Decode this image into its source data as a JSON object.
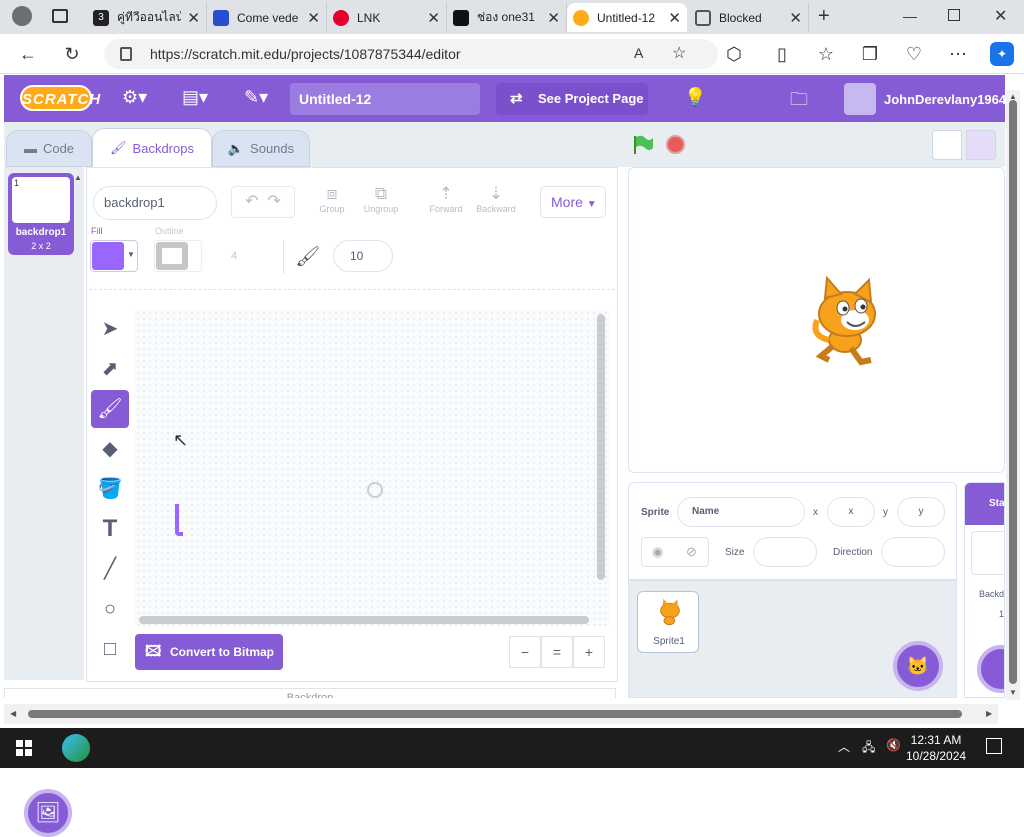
{
  "browser": {
    "tabs": [
      {
        "label": "คู่ทีวีออนไลน์",
        "color": "#222"
      },
      {
        "label": "Come vede",
        "color": "#2a4dd0"
      },
      {
        "label": "LNK",
        "color": "#e4002b"
      },
      {
        "label": "ช่อง one31",
        "color": "#111"
      },
      {
        "label": "Untitled-12",
        "color": "#ffab19"
      },
      {
        "label": "Blocked",
        "color": "#555"
      }
    ],
    "url": "https://scratch.mit.edu/projects/1087875344/editor",
    "close": "✕",
    "new_tab": "+"
  },
  "menubar": {
    "logo": "SCRATCH",
    "project_title": "Untitled-12",
    "see_project": "See Project Page",
    "username": "JohnDerevlany1964"
  },
  "editor_tabs": {
    "code": "Code",
    "backdrops": "Backdrops",
    "sounds": "Sounds"
  },
  "backdrop_list": {
    "items": [
      {
        "number": "1",
        "name": "backdrop1",
        "size": "2 x 2"
      }
    ]
  },
  "paint": {
    "name_value": "backdrop1",
    "group": "Group",
    "ungroup": "Ungroup",
    "forward": "Forward",
    "backward": "Backward",
    "more": "More",
    "fill_label": "Fill",
    "outline_label": "Outline",
    "outline_width": "4",
    "brush_size": "10",
    "convert": "Convert to Bitmap",
    "zoom_out": "−",
    "zoom_reset": "=",
    "zoom_in": "+",
    "bottom_label": "Backdrop"
  },
  "sprite_info": {
    "sprite_label": "Sprite",
    "name_placeholder": "Name",
    "x_label": "x",
    "x_placeholder": "x",
    "y_label": "y",
    "y_placeholder": "y",
    "size_label": "Size",
    "direction_label": "Direction"
  },
  "sprites": [
    {
      "name": "Sprite1"
    }
  ],
  "stage_panel": {
    "header": "Stage",
    "backdrops_label": "Backd",
    "backdrop_count": "1"
  },
  "taskbar": {
    "time": "12:31 AM",
    "date": "10/28/2024"
  },
  "colors": {
    "accent": "#855cd6",
    "fill": "#9966ff",
    "menubar": "#855cd6"
  }
}
